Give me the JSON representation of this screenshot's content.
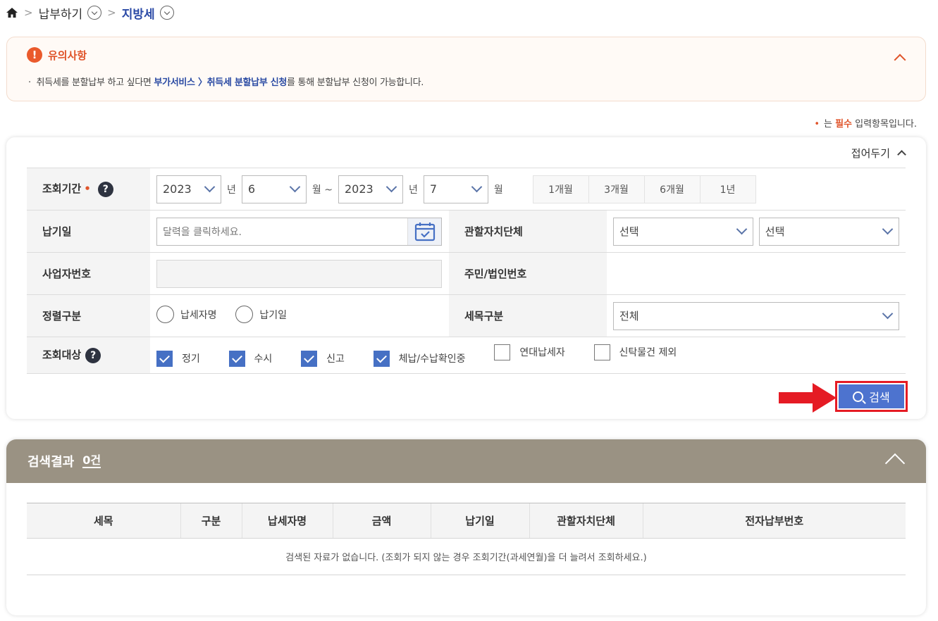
{
  "breadcrumb": {
    "home": "home",
    "item1": "납부하기",
    "item2": "지방세"
  },
  "notice": {
    "title": "유의사항",
    "text_pre": "취득세를 분할납부 하고 싶다면 ",
    "text_link": "부가서비스 〉취득세 분할납부 신청",
    "text_post": "를 통해 분할납부 신청이 가능합니다."
  },
  "required_note": {
    "dot": "•",
    "pre": "는 ",
    "strong": "필수",
    "post": " 입력항목입니다."
  },
  "form": {
    "fold_label": "접어두기",
    "period": {
      "label": "조회기간",
      "from_year": "2023",
      "year_unit": "년",
      "from_month": "6",
      "month_unit_tilde": "월 ~",
      "to_year": "2023",
      "year_unit2": "년",
      "to_month": "7",
      "month_unit": "월",
      "buttons": [
        "1개월",
        "3개월",
        "6개월",
        "1년"
      ]
    },
    "pay_date": {
      "label": "납기일",
      "placeholder": "달력을 클릭하세요."
    },
    "jurisdiction": {
      "label": "관할자치단체",
      "select1": "선택",
      "select2": "선택"
    },
    "business_no": {
      "label": "사업자번호"
    },
    "resident_no": {
      "label": "주민/법인번호"
    },
    "sort": {
      "label": "정렬구분",
      "opt1": "납세자명",
      "opt2": "납기일"
    },
    "tax_item": {
      "label": "세목구분",
      "value": "전체"
    },
    "target": {
      "label": "조회대상",
      "items": [
        {
          "label": "정기",
          "checked": true
        },
        {
          "label": "수시",
          "checked": true
        },
        {
          "label": "신고",
          "checked": true
        },
        {
          "label": "체납/수납확인중",
          "checked": true
        },
        {
          "label": "연대납세자",
          "checked": false
        },
        {
          "label": "신탁물건 제외",
          "checked": false
        }
      ]
    },
    "search_label": "검색"
  },
  "results": {
    "title": "검색결과",
    "count": "0건",
    "columns": [
      "세목",
      "구분",
      "납세자명",
      "금액",
      "납기일",
      "관할자치단체",
      "전자납부번호"
    ],
    "empty_message": "검색된 자료가 없습니다. (조회가 되지 않는 경우 조회기간(과세연월)을 더 늘려서 조회하세요.)"
  },
  "colors": {
    "accent": "#4d73cf",
    "warning": "#e0542a",
    "header_bg": "#9a9283",
    "highlight_border": "#e51b24"
  }
}
